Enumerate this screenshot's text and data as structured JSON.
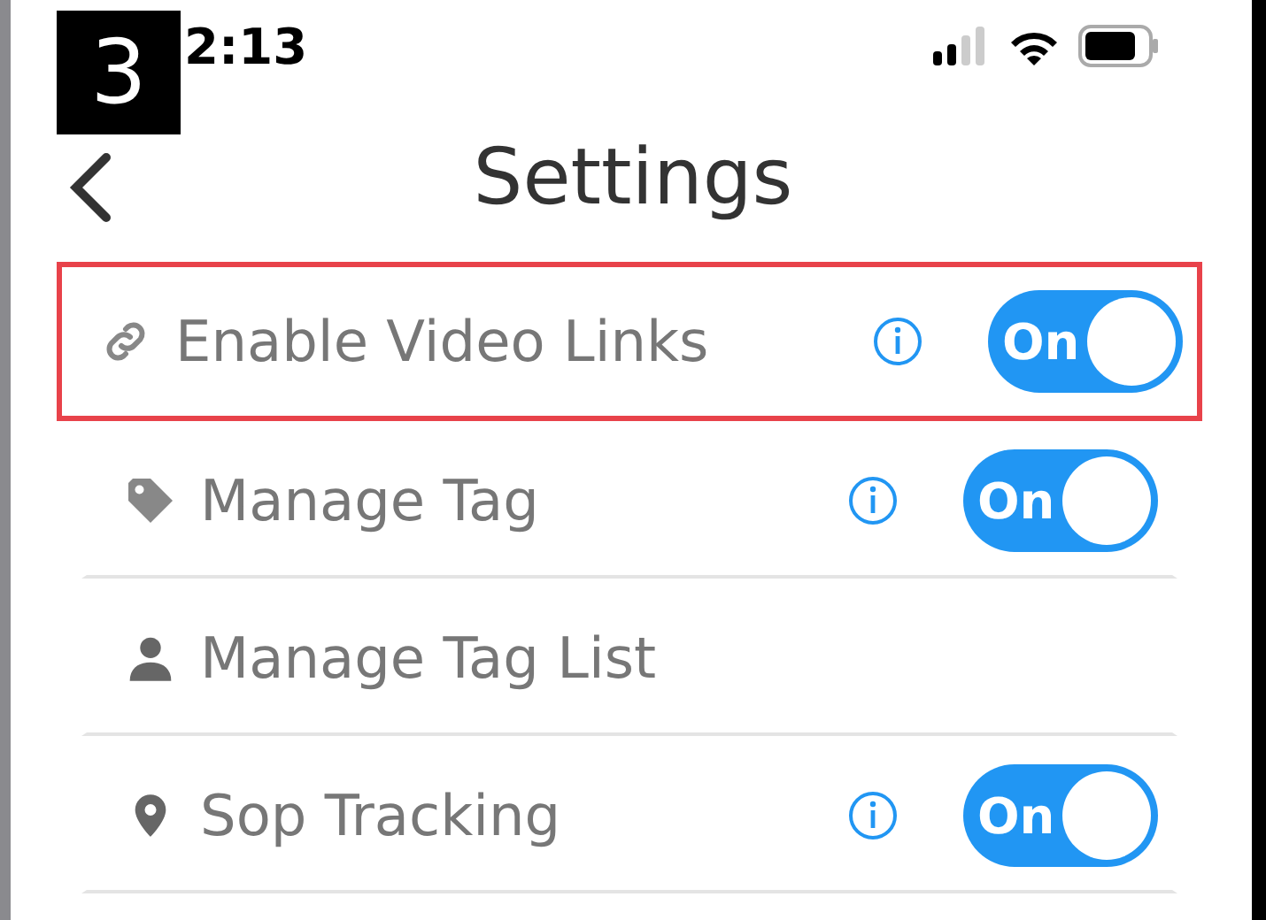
{
  "badge": "3",
  "status_bar": {
    "time": "2:13"
  },
  "header": {
    "title": "Settings"
  },
  "rows": [
    {
      "kind": "toggle",
      "label": "Enable Video Links",
      "info": true,
      "toggle_label": "On",
      "on": true,
      "highlighted": true
    },
    {
      "kind": "toggle",
      "label": "Manage Tag",
      "info": true,
      "toggle_label": "On",
      "on": true,
      "highlighted": false
    },
    {
      "kind": "link",
      "label": "Manage Tag List",
      "info": false,
      "highlighted": false
    },
    {
      "kind": "toggle",
      "label": "Sop Tracking",
      "info": true,
      "toggle_label": "On",
      "on": true,
      "highlighted": false
    }
  ]
}
